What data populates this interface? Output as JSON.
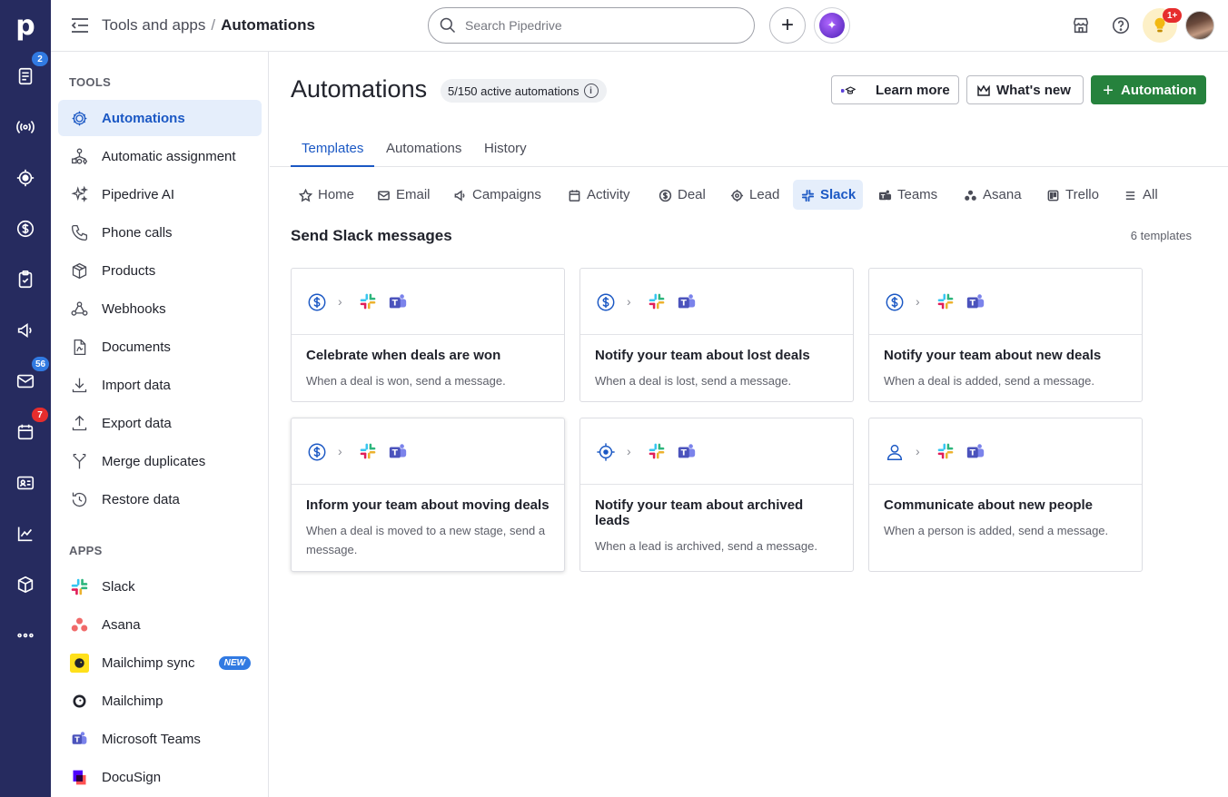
{
  "rail": {
    "logo": "p",
    "badges": {
      "activities": "2",
      "mail": "56",
      "calendar": "7"
    }
  },
  "topbar": {
    "breadcrumb_parent": "Tools and apps",
    "breadcrumb_sep": "/",
    "breadcrumb_current": "Automations",
    "search_placeholder": "Search Pipedrive",
    "notifications_badge": "1+"
  },
  "sidebar": {
    "tools_heading": "TOOLS",
    "tools": [
      {
        "label": "Automations",
        "icon": "automations-icon"
      },
      {
        "label": "Automatic assignment",
        "icon": "assignment-icon"
      },
      {
        "label": "Pipedrive AI",
        "icon": "sparkle-icon"
      },
      {
        "label": "Phone calls",
        "icon": "phone-icon"
      },
      {
        "label": "Products",
        "icon": "box-icon"
      },
      {
        "label": "Webhooks",
        "icon": "webhook-icon"
      },
      {
        "label": "Documents",
        "icon": "document-icon"
      },
      {
        "label": "Import data",
        "icon": "import-icon"
      },
      {
        "label": "Export data",
        "icon": "export-icon"
      },
      {
        "label": "Merge duplicates",
        "icon": "merge-icon"
      },
      {
        "label": "Restore data",
        "icon": "restore-icon"
      }
    ],
    "apps_heading": "APPS",
    "apps": [
      {
        "label": "Slack",
        "icon": "slack-icon"
      },
      {
        "label": "Asana",
        "icon": "asana-icon"
      },
      {
        "label": "Mailchimp sync",
        "icon": "mailchimp-icon",
        "badge": "NEW"
      },
      {
        "label": "Mailchimp",
        "icon": "mailchimp-icon"
      },
      {
        "label": "Microsoft Teams",
        "icon": "teams-icon"
      },
      {
        "label": "DocuSign",
        "icon": "docusign-icon"
      }
    ]
  },
  "main": {
    "title": "Automations",
    "active_count": "5/150 active automations",
    "buttons": {
      "learn_more": "Learn more",
      "whats_new": "What's new",
      "automation": "Automation"
    },
    "tabs": [
      "Templates",
      "Automations",
      "History"
    ],
    "chips": [
      "Home",
      "Email",
      "Campaigns",
      "Activity",
      "Deal",
      "Lead",
      "Slack",
      "Teams",
      "Asana",
      "Trello",
      "All"
    ],
    "section_title": "Send Slack messages",
    "template_count": "6 templates",
    "cards": [
      {
        "title": "Celebrate when deals are won",
        "desc": "When a deal is won, send a message.",
        "trigger": "deal-icon"
      },
      {
        "title": "Notify your team about lost deals",
        "desc": "When a deal is lost, send a message.",
        "trigger": "deal-icon"
      },
      {
        "title": "Notify your team about new deals",
        "desc": "When a deal is added, send a message.",
        "trigger": "deal-icon"
      },
      {
        "title": "Inform your team about moving deals",
        "desc": "When a deal is moved to a new stage, send a message.",
        "trigger": "deal-icon"
      },
      {
        "title": "Notify your team about archived leads",
        "desc": "When a lead is archived, send a message.",
        "trigger": "lead-icon"
      },
      {
        "title": "Communicate about new people",
        "desc": "When a person is added, send a message.",
        "trigger": "person-icon"
      }
    ]
  },
  "colors": {
    "rail": "#262b5f",
    "accent": "#1b58c4",
    "primary_button": "#26823d",
    "badge_blue": "#317ae2",
    "badge_red": "#e62d2d"
  }
}
